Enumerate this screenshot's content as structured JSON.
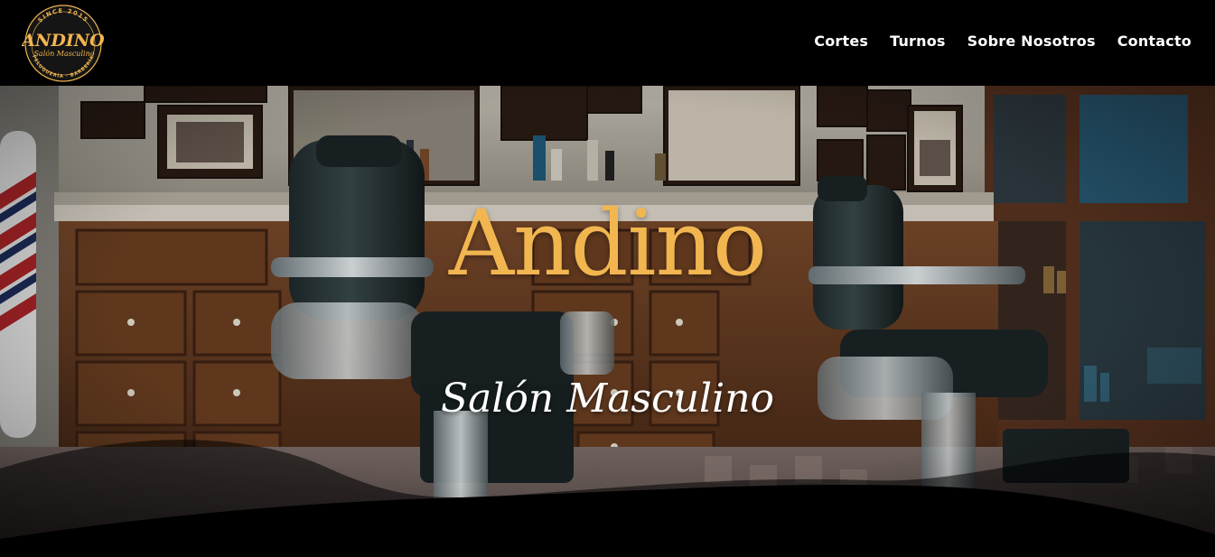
{
  "logo": {
    "top_arc": "SINCE 2015",
    "name": "ANDINO",
    "tagline": "Salón Masculino",
    "bottom_arc": "PELUQUERÍA · BARBERÍA"
  },
  "nav": {
    "items": [
      {
        "label": "Cortes"
      },
      {
        "label": "Turnos"
      },
      {
        "label": "Sobre Nosotros"
      },
      {
        "label": "Contacto"
      }
    ]
  },
  "hero": {
    "title": "Andino",
    "subtitle": "Salón Masculino"
  },
  "colors": {
    "header_bg": "#000000",
    "accent_gold": "#f2b650",
    "text_white": "#ffffff"
  }
}
